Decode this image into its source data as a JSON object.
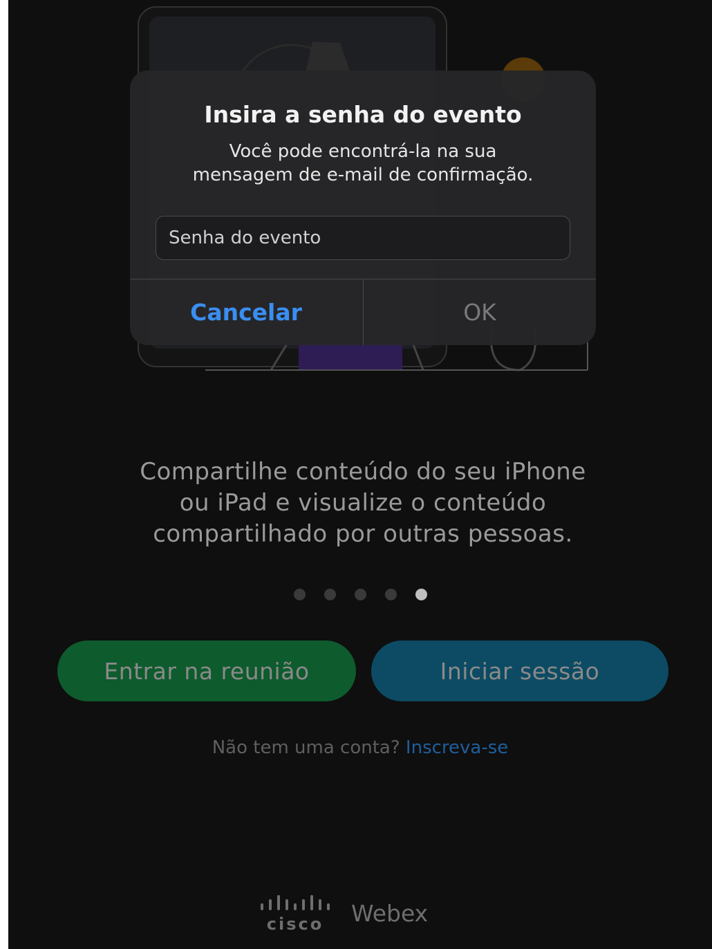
{
  "dialog": {
    "title": "Insira a senha do evento",
    "message": "Você pode encontrá-la na sua\nmensagem de e-mail de confirmação.",
    "input_placeholder": "Senha do evento",
    "cancel_label": "Cancelar",
    "ok_label": "OK"
  },
  "onboarding": {
    "description": "Compartilhe conteúdo do seu iPhone\nou iPad e visualize o conteúdo\ncompartilhado por outras pessoas.",
    "page_count": 5,
    "active_page": 5
  },
  "actions": {
    "join_label": "Entrar na reunião",
    "signin_label": "Iniciar sessão"
  },
  "signup": {
    "prompt": "Não tem uma conta?",
    "link_label": "Inscreva-se"
  },
  "brand": {
    "logo_wordmark": "cisco",
    "product_name": "Webex"
  },
  "colors": {
    "join_button": "#0e5b2d",
    "signin_button": "#0c4b63",
    "link": "#1f5e9c",
    "dialog_accent": "#3a8ef0"
  }
}
